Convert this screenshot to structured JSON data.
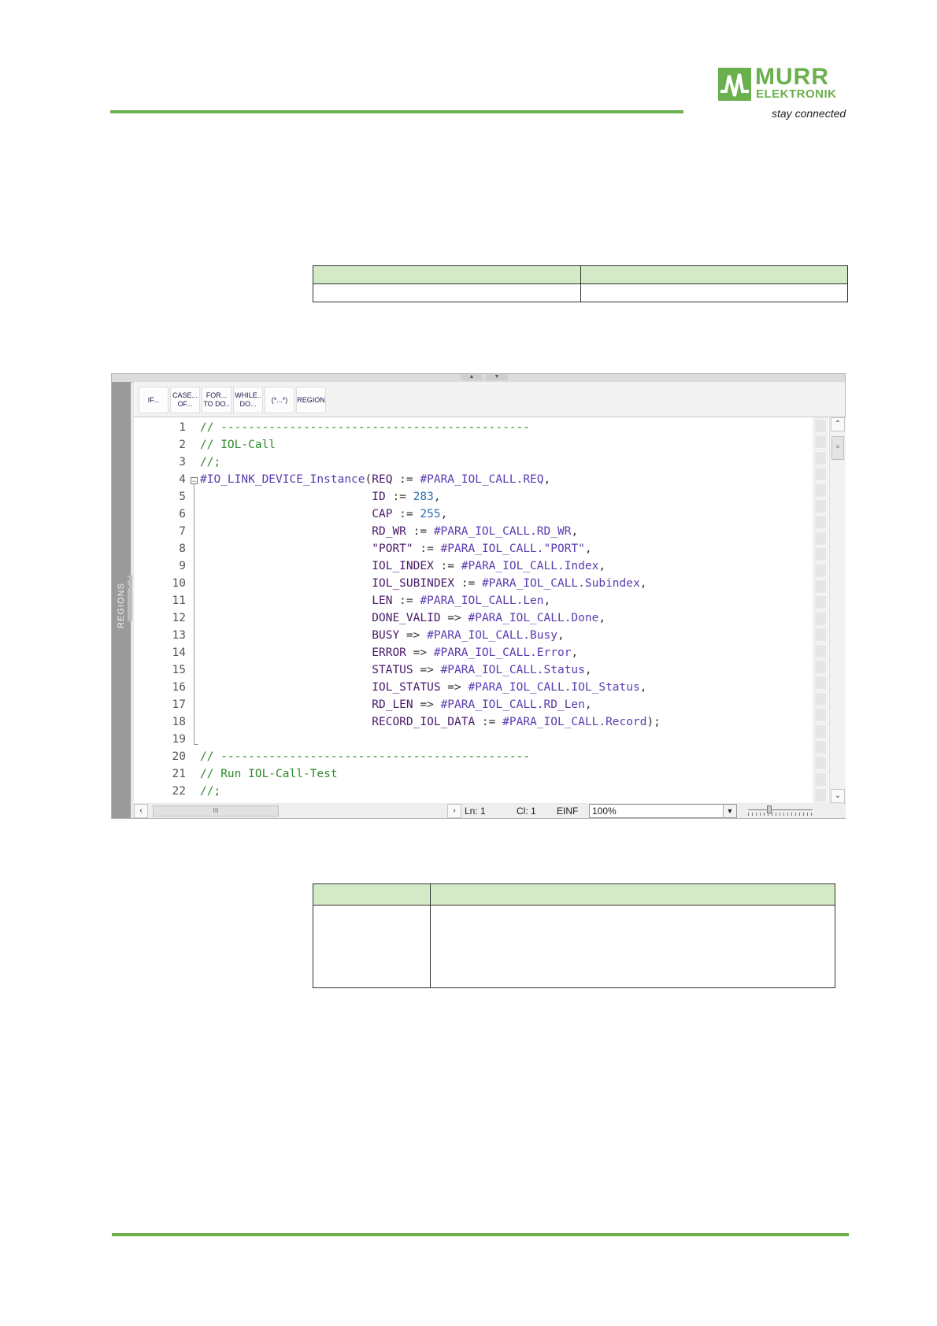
{
  "logo": {
    "brand": "MURR",
    "sub": "ELEKTRONIK",
    "tagline": "stay connected"
  },
  "editor": {
    "toolbar": [
      {
        "line1": "IF...",
        "line2": ""
      },
      {
        "line1": "CASE...",
        "line2": "OF..."
      },
      {
        "line1": "FOR...",
        "line2": "TO DO.."
      },
      {
        "line1": "WHILE..",
        "line2": "DO..."
      },
      {
        "line1": "(*...*)",
        "line2": ""
      },
      {
        "line1": "REGION",
        "line2": ""
      }
    ],
    "regions_label": "REGIONS",
    "lines": [
      {
        "n": "1",
        "parts": [
          {
            "t": "// ---------------------------------------------",
            "c": "cmt"
          }
        ]
      },
      {
        "n": "2",
        "parts": [
          {
            "t": "// IOL-Call",
            "c": "cmt"
          }
        ]
      },
      {
        "n": "3",
        "parts": [
          {
            "t": "//;",
            "c": "cmt"
          }
        ]
      },
      {
        "n": "4",
        "parts": [
          {
            "t": "#IO_LINK_DEVICE_Instance",
            "c": "var"
          },
          {
            "t": "(",
            "c": "op"
          },
          {
            "t": "REQ",
            "c": "id"
          },
          {
            "t": " := ",
            "c": "op"
          },
          {
            "t": "#PARA_IOL_CALL.REQ",
            "c": "var"
          },
          {
            "t": ",",
            "c": "op"
          }
        ]
      },
      {
        "n": "5",
        "parts": [
          {
            "t": "                         ",
            "c": "op"
          },
          {
            "t": "ID",
            "c": "id"
          },
          {
            "t": " := ",
            "c": "op"
          },
          {
            "t": "283",
            "c": "num"
          },
          {
            "t": ",",
            "c": "op"
          }
        ]
      },
      {
        "n": "6",
        "parts": [
          {
            "t": "                         ",
            "c": "op"
          },
          {
            "t": "CAP",
            "c": "id"
          },
          {
            "t": " := ",
            "c": "op"
          },
          {
            "t": "255",
            "c": "num"
          },
          {
            "t": ",",
            "c": "op"
          }
        ]
      },
      {
        "n": "7",
        "parts": [
          {
            "t": "                         ",
            "c": "op"
          },
          {
            "t": "RD_WR",
            "c": "id"
          },
          {
            "t": " := ",
            "c": "op"
          },
          {
            "t": "#PARA_IOL_CALL.RD_WR",
            "c": "var"
          },
          {
            "t": ",",
            "c": "op"
          }
        ]
      },
      {
        "n": "8",
        "parts": [
          {
            "t": "                         ",
            "c": "op"
          },
          {
            "t": "\"PORT\"",
            "c": "id"
          },
          {
            "t": " := ",
            "c": "op"
          },
          {
            "t": "#PARA_IOL_CALL.\"PORT\"",
            "c": "var"
          },
          {
            "t": ",",
            "c": "op"
          }
        ]
      },
      {
        "n": "9",
        "parts": [
          {
            "t": "                         ",
            "c": "op"
          },
          {
            "t": "IOL_INDEX",
            "c": "id"
          },
          {
            "t": " := ",
            "c": "op"
          },
          {
            "t": "#PARA_IOL_CALL.Index",
            "c": "var"
          },
          {
            "t": ",",
            "c": "op"
          }
        ]
      },
      {
        "n": "10",
        "parts": [
          {
            "t": "                         ",
            "c": "op"
          },
          {
            "t": "IOL_SUBINDEX",
            "c": "id"
          },
          {
            "t": " := ",
            "c": "op"
          },
          {
            "t": "#PARA_IOL_CALL.Subindex",
            "c": "var"
          },
          {
            "t": ",",
            "c": "op"
          }
        ]
      },
      {
        "n": "11",
        "parts": [
          {
            "t": "                         ",
            "c": "op"
          },
          {
            "t": "LEN",
            "c": "id"
          },
          {
            "t": " := ",
            "c": "op"
          },
          {
            "t": "#PARA_IOL_CALL.Len",
            "c": "var"
          },
          {
            "t": ",",
            "c": "op"
          }
        ]
      },
      {
        "n": "12",
        "parts": [
          {
            "t": "                         ",
            "c": "op"
          },
          {
            "t": "DONE_VALID",
            "c": "id"
          },
          {
            "t": " => ",
            "c": "op"
          },
          {
            "t": "#PARA_IOL_CALL.Done",
            "c": "var"
          },
          {
            "t": ",",
            "c": "op"
          }
        ]
      },
      {
        "n": "13",
        "parts": [
          {
            "t": "                         ",
            "c": "op"
          },
          {
            "t": "BUSY",
            "c": "id"
          },
          {
            "t": " => ",
            "c": "op"
          },
          {
            "t": "#PARA_IOL_CALL.Busy",
            "c": "var"
          },
          {
            "t": ",",
            "c": "op"
          }
        ]
      },
      {
        "n": "14",
        "parts": [
          {
            "t": "                         ",
            "c": "op"
          },
          {
            "t": "ERROR",
            "c": "id"
          },
          {
            "t": " => ",
            "c": "op"
          },
          {
            "t": "#PARA_IOL_CALL.Error",
            "c": "var"
          },
          {
            "t": ",",
            "c": "op"
          }
        ]
      },
      {
        "n": "15",
        "parts": [
          {
            "t": "                         ",
            "c": "op"
          },
          {
            "t": "STATUS",
            "c": "id"
          },
          {
            "t": " => ",
            "c": "op"
          },
          {
            "t": "#PARA_IOL_CALL.Status",
            "c": "var"
          },
          {
            "t": ",",
            "c": "op"
          }
        ]
      },
      {
        "n": "16",
        "parts": [
          {
            "t": "                         ",
            "c": "op"
          },
          {
            "t": "IOL_STATUS",
            "c": "id"
          },
          {
            "t": " => ",
            "c": "op"
          },
          {
            "t": "#PARA_IOL_CALL.IOL_Status",
            "c": "var"
          },
          {
            "t": ",",
            "c": "op"
          }
        ]
      },
      {
        "n": "17",
        "parts": [
          {
            "t": "                         ",
            "c": "op"
          },
          {
            "t": "RD_LEN",
            "c": "id"
          },
          {
            "t": " => ",
            "c": "op"
          },
          {
            "t": "#PARA_IOL_CALL.RD_Len",
            "c": "var"
          },
          {
            "t": ",",
            "c": "op"
          }
        ]
      },
      {
        "n": "18",
        "parts": [
          {
            "t": "                         ",
            "c": "op"
          },
          {
            "t": "RECORD_IOL_DATA",
            "c": "id"
          },
          {
            "t": " := ",
            "c": "op"
          },
          {
            "t": "#PARA_IOL_CALL.Record",
            "c": "var"
          },
          {
            "t": ");",
            "c": "op"
          }
        ]
      },
      {
        "n": "19",
        "parts": []
      },
      {
        "n": "20",
        "parts": [
          {
            "t": "// ---------------------------------------------",
            "c": "cmt"
          }
        ]
      },
      {
        "n": "21",
        "parts": [
          {
            "t": "// Run IOL-Call-Test",
            "c": "cmt"
          }
        ]
      },
      {
        "n": "22",
        "parts": [
          {
            "t": "//;",
            "c": "cmt"
          }
        ]
      }
    ],
    "status": {
      "ln": "Ln: 1",
      "cl": "Cl: 1",
      "mode": "EINF",
      "zoom": "100%"
    }
  },
  "colors": {
    "accent_green": "#6ab04c",
    "table_header": "#d4e9c6"
  }
}
